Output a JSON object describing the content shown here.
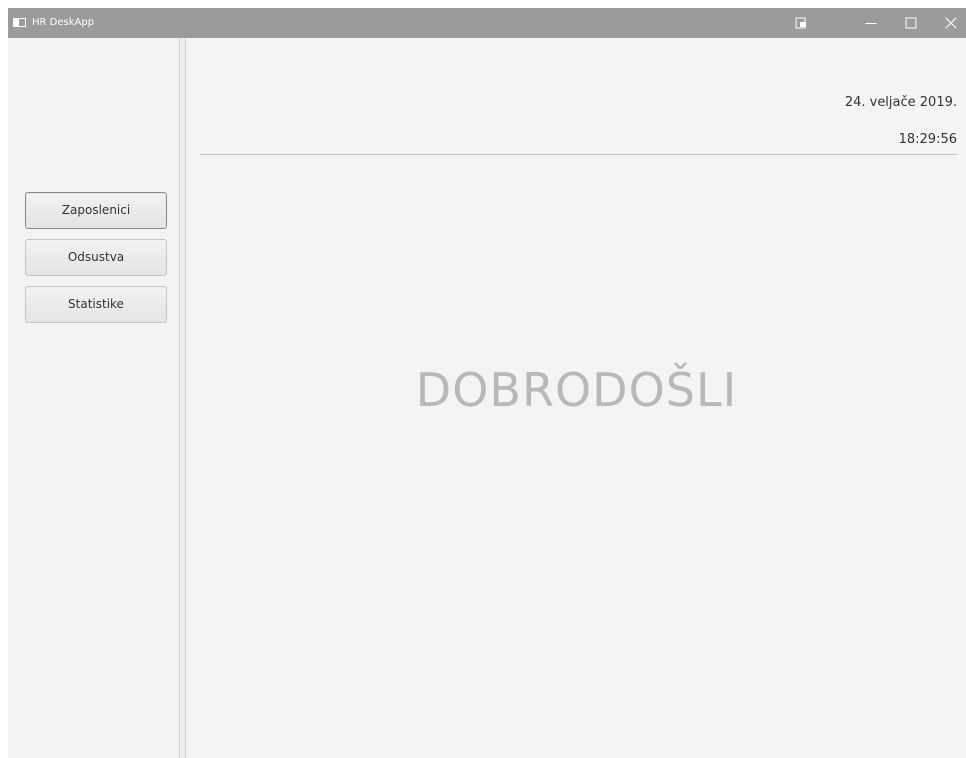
{
  "window": {
    "title": "HR DeskApp"
  },
  "titlebar_icons": {
    "app": "app-window-icon",
    "snap": "snap-layout-icon",
    "minimize": "minimize-icon",
    "maximize": "maximize-icon",
    "close": "close-icon"
  },
  "sidebar": {
    "items": [
      {
        "label": "Zaposlenici",
        "focused": true
      },
      {
        "label": "Odsustva",
        "focused": false
      },
      {
        "label": "Statistike",
        "focused": false
      }
    ]
  },
  "header": {
    "date": "24. veljače 2019.",
    "time": "18:29:56"
  },
  "main": {
    "welcome": "DOBRODOŠLI"
  },
  "colors": {
    "titlebar": "#9b9b9b",
    "background": "#f3f3f3",
    "welcome_text": "#b8b8b8"
  }
}
